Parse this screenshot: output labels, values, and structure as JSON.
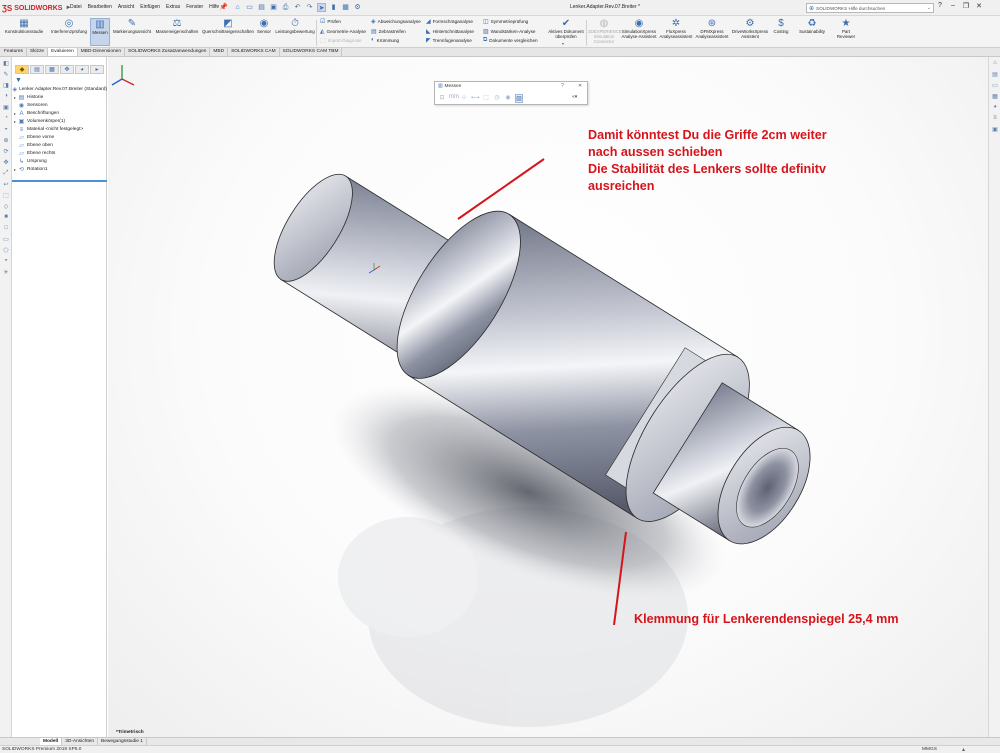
{
  "app": {
    "brand": "SOLIDWORKS",
    "doc_title": "Lenker.Adapter.Rev.07.Breiter *",
    "search_placeholder": "SOLIDWORKS Hilfe durchsuchen"
  },
  "menu": [
    "Datei",
    "Bearbeiten",
    "Ansicht",
    "Einfügen",
    "Extras",
    "Fenster",
    "Hilfe"
  ],
  "commands": {
    "konstruktion": "Konstruktionsstudie",
    "interferenz": "Interferenzprüfung",
    "messen": "Messen",
    "markierung": "Markierungsansicht",
    "masseneig": "Masseneigenschaften",
    "querschnitt": "Querschnittseigenschaften",
    "sensor": "Sensor",
    "leistung": "Leistungsbewertung",
    "pruefen": "Prüfen",
    "geometrie": "Geometrie-Analyse",
    "import": "Import-Diagnose",
    "abweichung": "Abweichungsanalyse",
    "zebra": "Zebrastreifen",
    "kruemmung": "Krümmung",
    "formschraege": "Formschräganalyse",
    "hinterschnitt": "Hinterschnittanalyse",
    "trennfugen": "Trennfugenanalyse",
    "symmetrie": "Symmetrieprüfung",
    "wandstaerke": "Wandstärken-Analyse",
    "vergleichen": "Dokumente vergleichen",
    "aktives_l1": "Aktives Dokument",
    "aktives_l2": "überprüfen",
    "experience_l1": "3DEXPERIENCE",
    "experience_l2": "Simulation",
    "experience_l3": "Connector",
    "simx_l1": "SimulationXpress",
    "simx_l2": "Analyse-Assistent",
    "flox_l1": "FloXpress",
    "flox_l2": "Analyseassistent",
    "dfmx_l1": "DFMXpress",
    "dfmx_l2": "Analyseassistent",
    "driveworks_l1": "DriveWorksXpress",
    "driveworks_l2": "Assistent",
    "costing": "Costing",
    "sustain": "Sustainability",
    "part_l1": "Part",
    "part_l2": "Reviewer"
  },
  "tabs": [
    "Features",
    "Skizze",
    "Evaluieren",
    "MBD-Dimensionen",
    "SOLIDWORKS Zusatzanwendungen",
    "MBD",
    "SOLIDWORKS CAM",
    "SOLIDWORKS CAM TBM"
  ],
  "tree": {
    "items": [
      {
        "label": "Lenker.Adapter.Rev.07.Breiter  (Standard)",
        "icon": "part-icon"
      },
      {
        "label": "Historie",
        "icon": "history-icon"
      },
      {
        "label": "Sensoren",
        "icon": "sensor-icon"
      },
      {
        "label": "Beschriftungen",
        "icon": "annotation-icon"
      },
      {
        "label": "Volumenkörper(1)",
        "icon": "solid-bodies-icon"
      },
      {
        "label": "Material <nicht festgelegt>",
        "icon": "material-icon"
      },
      {
        "label": "Ebene vorne",
        "icon": "plane-icon"
      },
      {
        "label": "Ebene oben",
        "icon": "plane-icon"
      },
      {
        "label": "Ebene rechts",
        "icon": "plane-icon"
      },
      {
        "label": "Ursprung",
        "icon": "origin-icon"
      },
      {
        "label": "Rotation1",
        "icon": "revolve-icon"
      }
    ]
  },
  "messen_dialog": {
    "title": "Messen",
    "help": "?",
    "close": "✕"
  },
  "annotations": {
    "top_l1": "Damit könntest Du die Griffe 2cm weiter",
    "top_l2": "nach aussen schieben",
    "top_l3": "Die Stabilität des Lenkers sollte definitv",
    "top_l4": "ausreichen",
    "bottom": "Klemmung für Lenkerendenspiegel 25,4 mm"
  },
  "view_label": "*Trimetrisch",
  "bottom_tabs": [
    "Modell",
    "3D-Ansichten",
    "Bewegungsstudie 1"
  ],
  "status": {
    "left": "SOLIDWORKS Premium 2019 SP5.0",
    "units": "MMGS"
  },
  "colors": {
    "annotation": "#d6141c",
    "brand": "#d2202a",
    "accent": "#3d6fb0"
  }
}
